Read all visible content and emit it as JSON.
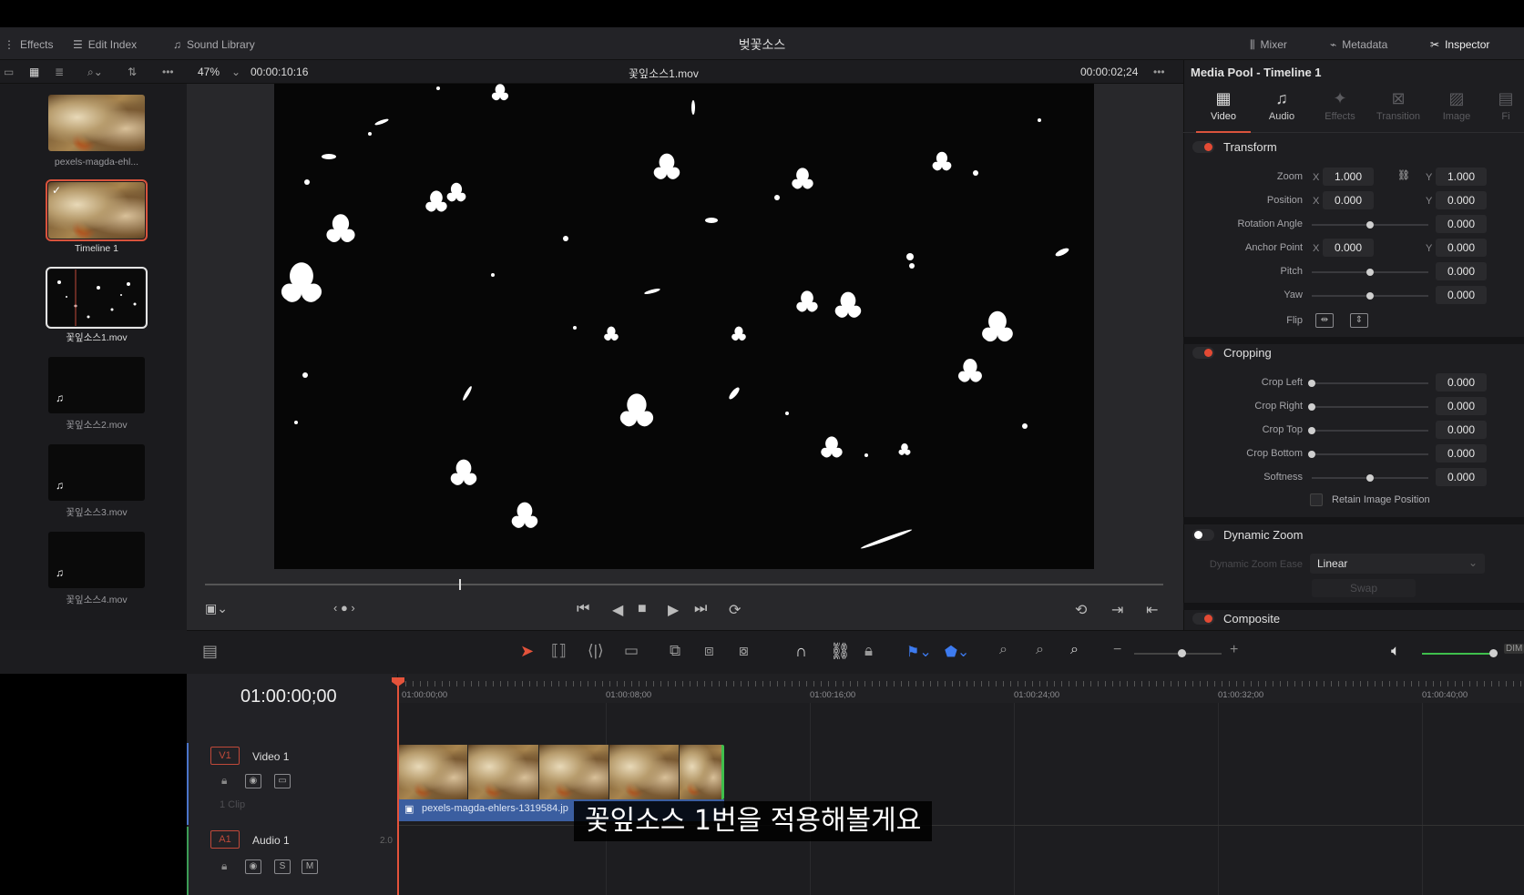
{
  "topbar": {
    "title": "벚꽃소스",
    "effects": "Effects",
    "edit_index": "Edit Index",
    "sound_library": "Sound Library",
    "mixer": "Mixer",
    "metadata": "Metadata",
    "inspector": "Inspector"
  },
  "viewer": {
    "zoom": "47%",
    "duration_timecode": "00:00:10:16",
    "clip_name": "꽃잎소스1.mov",
    "current_timecode": "00:00:02;24"
  },
  "media_pool": {
    "items": [
      {
        "label": "pexels-magda-ehl...",
        "kind": "image"
      },
      {
        "label": "Timeline 1",
        "kind": "timeline"
      },
      {
        "label": "꽃잎소스1.mov",
        "kind": "video"
      },
      {
        "label": "꽃잎소스2.mov",
        "kind": "audio"
      },
      {
        "label": "꽃잎소스3.mov",
        "kind": "audio"
      },
      {
        "label": "꽃잎소스4.mov",
        "kind": "audio"
      }
    ]
  },
  "inspector": {
    "title": "Media Pool - Timeline 1",
    "tabs": [
      {
        "label": "Video",
        "active": true
      },
      {
        "label": "Audio",
        "active": false
      },
      {
        "label": "Effects",
        "active": false
      },
      {
        "label": "Transition",
        "active": false
      },
      {
        "label": "Image",
        "active": false
      },
      {
        "label": "Fi",
        "active": false
      }
    ],
    "transform": {
      "label": "Transform",
      "zoom_label": "Zoom",
      "zoom_x": "1.000",
      "zoom_y": "1.000",
      "position_label": "Position",
      "position_x": "0.000",
      "position_y": "0.000",
      "rotation_label": "Rotation Angle",
      "rotation": "0.000",
      "anchor_label": "Anchor Point",
      "anchor_x": "0.000",
      "anchor_y": "0.000",
      "pitch_label": "Pitch",
      "pitch": "0.000",
      "yaw_label": "Yaw",
      "yaw": "0.000",
      "flip_label": "Flip",
      "x": "X",
      "y": "Y"
    },
    "cropping": {
      "label": "Cropping",
      "left_label": "Crop Left",
      "left": "0.000",
      "right_label": "Crop Right",
      "right": "0.000",
      "top_label": "Crop Top",
      "top": "0.000",
      "bottom_label": "Crop Bottom",
      "bottom": "0.000",
      "softness_label": "Softness",
      "softness": "0.000",
      "retain_label": "Retain Image Position"
    },
    "dynamic_zoom": {
      "label": "Dynamic Zoom",
      "ease_label": "Dynamic Zoom Ease",
      "ease_value": "Linear",
      "swap_label": "Swap"
    },
    "composite": {
      "label": "Composite"
    }
  },
  "timeline": {
    "timecode": "01:00:00;00",
    "ruler": [
      "01:00:00;00",
      "01:00:08;00",
      "01:00:16;00",
      "01:00:24;00",
      "01:00:32;00",
      "01:00:40;00"
    ],
    "v1": {
      "badge": "V1",
      "name": "Video 1",
      "clips": "1 Clip"
    },
    "a1": {
      "badge": "A1",
      "name": "Audio 1",
      "channels": "2.0",
      "solo": "S",
      "mute": "M"
    },
    "clip_name": "pexels-magda-ehlers-1319584.jp",
    "dim_label": "DIM"
  },
  "subtitle": "꽃잎소스 1번을 적용해볼게요",
  "colors": {
    "accent": "#e4533b",
    "video_track": "#4a74c9",
    "audio_track": "#3c9c55",
    "clip_strip": "#3b5ea0"
  }
}
